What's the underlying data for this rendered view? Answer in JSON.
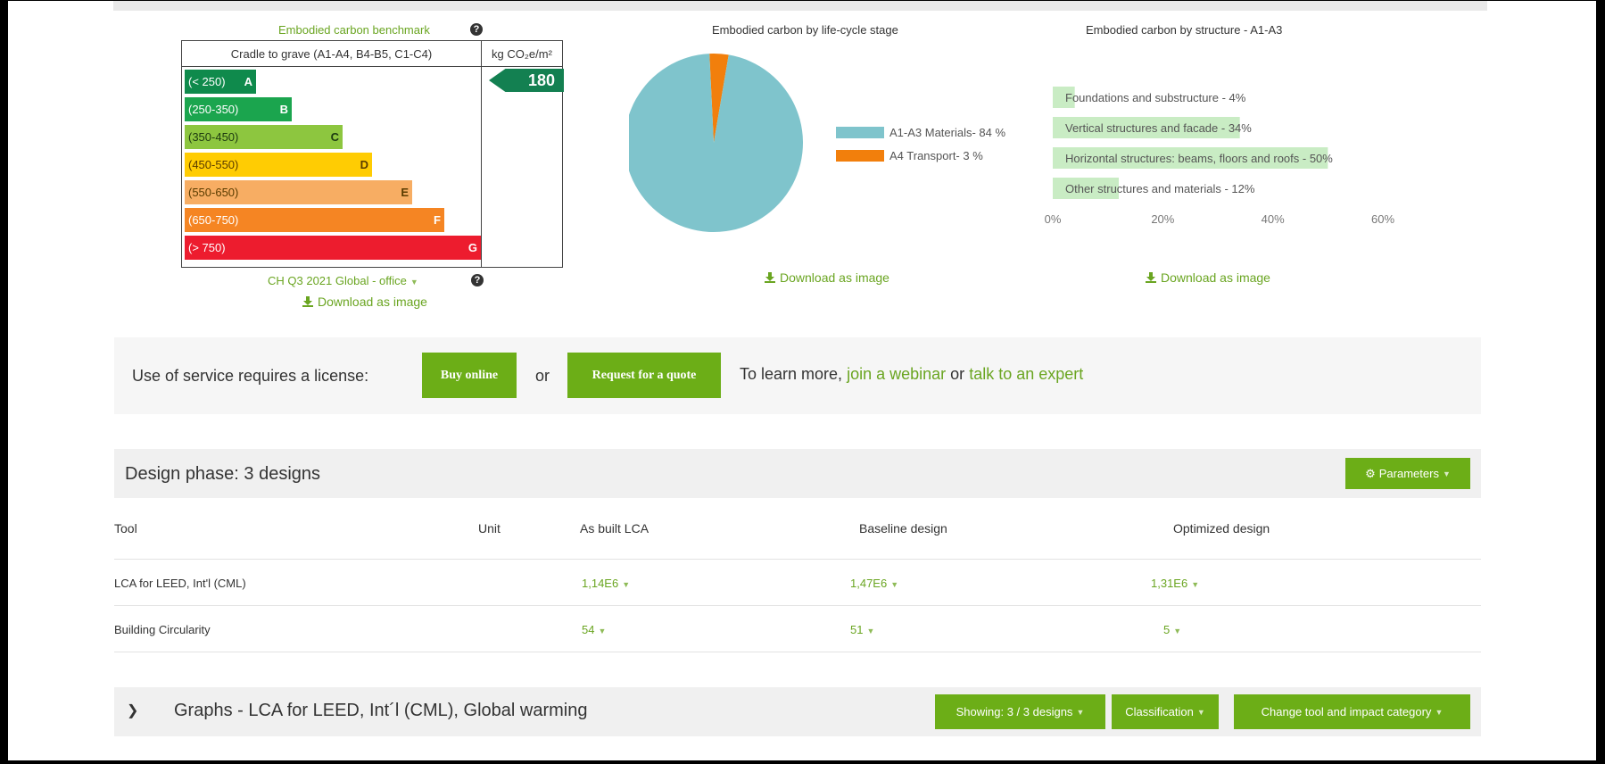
{
  "benchmark": {
    "title": "Embodied carbon benchmark",
    "scope_header": "Cradle to grave (A1-A4, B4-B5, C1-C4)",
    "unit_header": "kg CO₂e/m²",
    "value": "180",
    "bands": [
      {
        "range": "(< 250)",
        "letter": "A",
        "color": "#0f8a4c"
      },
      {
        "range": "(250-350)",
        "letter": "B",
        "color": "#1ba54e"
      },
      {
        "range": "(350-450)",
        "letter": "C",
        "color": "#8dc63f"
      },
      {
        "range": "(450-550)",
        "letter": "D",
        "color": "#ffcc03"
      },
      {
        "range": "(550-650)",
        "letter": "E",
        "color": "#f7ad63"
      },
      {
        "range": "(650-750)",
        "letter": "F",
        "color": "#f58523"
      },
      {
        "range": "(> 750)",
        "letter": "G",
        "color": "#ed1c2e"
      }
    ],
    "reference": "CH Q3 2021 Global - office",
    "download": "Download as image"
  },
  "pie": {
    "title": "Embodied carbon by life-cycle stage",
    "download": "Download as image"
  },
  "structure": {
    "title": "Embodied carbon by structure - A1-A3",
    "download": "Download as image"
  },
  "chart_data": [
    {
      "type": "pie",
      "title": "Embodied carbon by life-cycle stage",
      "labels": [
        "A1-A3 Materials- 84 %",
        "A4 Transport- 3 %"
      ],
      "values": [
        84,
        3
      ],
      "colors": [
        "#7fc4cc",
        "#f27f0c"
      ],
      "legend": "right"
    },
    {
      "type": "bar",
      "orientation": "horizontal",
      "title": "Embodied carbon by structure - A1-A3",
      "categories": [
        "Foundations and substructure - 4%",
        "Vertical structures and facade - 34%",
        "Horizontal structures: beams, floors and roofs - 50%",
        "Other structures and materials - 12%"
      ],
      "values": [
        4,
        34,
        50,
        12
      ],
      "xlim": [
        0,
        60
      ],
      "xticks": [
        "0%",
        "20%",
        "40%",
        "60%"
      ],
      "color": "#c9ecc4"
    }
  ],
  "license": {
    "text": "Use of service requires a license:",
    "buy": "Buy online",
    "or": "or",
    "quote": "Request for a quote",
    "learn": "To learn more,",
    "webinar": "join a webinar",
    "or2": "or",
    "expert": "talk to an expert"
  },
  "design": {
    "title": "Design phase: 3 designs",
    "parameters": "Parameters",
    "columns": [
      "Tool",
      "Unit",
      "As built LCA",
      "Baseline design",
      "Optimized design"
    ],
    "rows": [
      {
        "tool": "LCA for LEED, Int'l (CML)",
        "unit": "",
        "asbuilt": "1,14E6",
        "baseline": "1,47E6",
        "optimized": "1,31E6"
      },
      {
        "tool": "Building Circularity",
        "unit": "",
        "asbuilt": "54",
        "baseline": "51",
        "optimized": "5"
      }
    ]
  },
  "graphs": {
    "title": "Graphs - LCA for LEED, Int´l (CML), Global warming",
    "showing": "Showing: 3 / 3 designs",
    "classification": "Classification",
    "change": "Change tool and impact category"
  }
}
